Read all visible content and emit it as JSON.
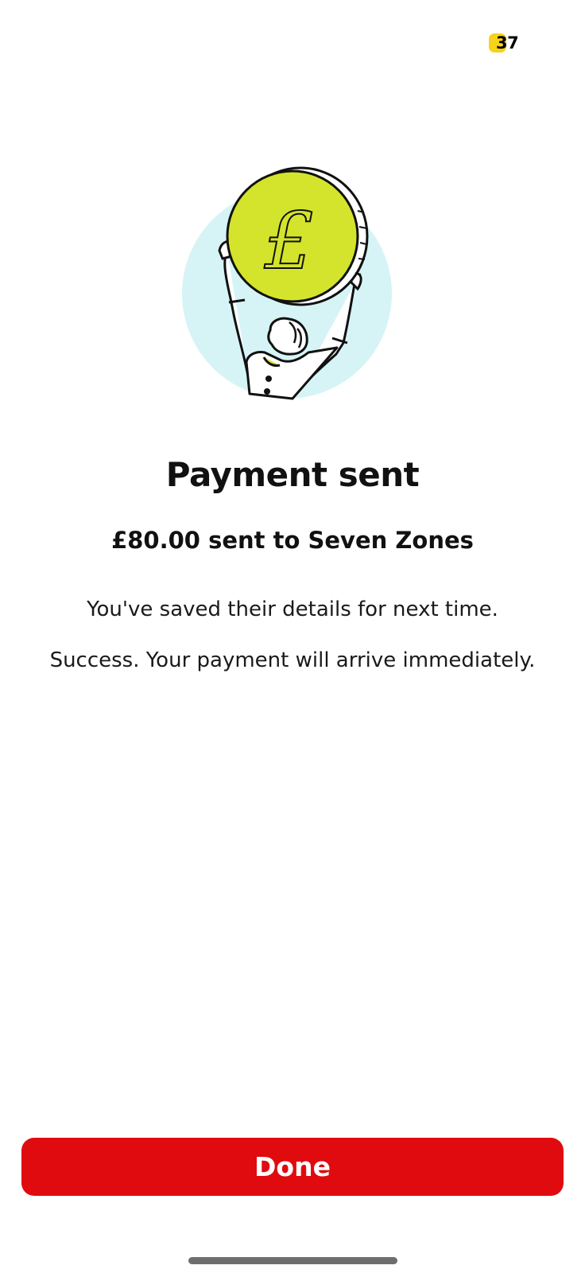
{
  "status": {
    "badge_count": "37",
    "badge_color": "#f7d21b"
  },
  "illustration": {
    "icon": "person-holding-pound-coin-icon",
    "coin_symbol": "£",
    "coin_color": "#d4e42c",
    "background_circle_color": "#d6f4f6"
  },
  "confirmation": {
    "title": "Payment sent",
    "subtitle": "£80.00 sent to Seven Zones",
    "message_saved": "You've saved their details for next time.",
    "message_arrival": "Success. Your payment will arrive immediately."
  },
  "actions": {
    "done_label": "Done",
    "done_color": "#e00b0e"
  }
}
